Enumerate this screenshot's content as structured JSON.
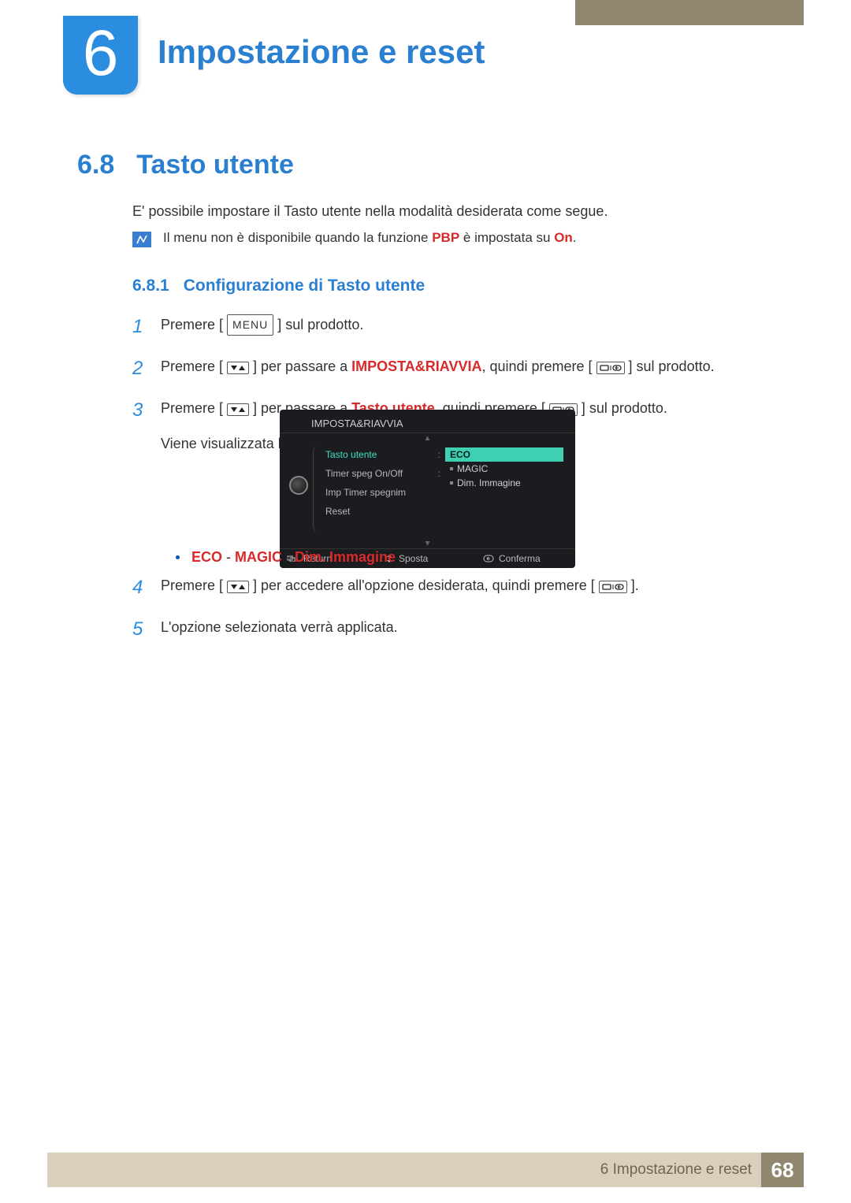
{
  "chapter": {
    "num": "6",
    "title": "Impostazione e reset"
  },
  "section": {
    "num": "6.8",
    "title": "Tasto utente"
  },
  "intro": "E' possibile impostare il Tasto utente nella modalità desiderata come segue.",
  "note": {
    "pre": "Il menu non è disponibile quando la funzione ",
    "pbp": "PBP",
    "mid": " è impostata su ",
    "on": "On",
    "post": "."
  },
  "subsection": {
    "num": "6.8.1",
    "title": "Configurazione di Tasto utente"
  },
  "buttons": {
    "menu": "MENU"
  },
  "steps": {
    "s1": {
      "n": "1",
      "a": "Premere [ ",
      "b": " ] sul prodotto."
    },
    "s2": {
      "n": "2",
      "a": "Premere [ ",
      "b": " ] per passare a ",
      "kw": "IMPOSTA&RIAVVIA",
      "c": ", quindi premere [ ",
      "d": " ] sul prodotto."
    },
    "s3": {
      "n": "3",
      "a": "Premere [ ",
      "b": " ] per passare a ",
      "kw": "Tasto utente",
      "c": ", quindi premere [ ",
      "d": " ] sul prodotto."
    },
    "s3b": "Viene visualizzata la seguente schermata.",
    "s4": {
      "n": "4",
      "a": "Premere [ ",
      "b": " ] per accedere all'opzione desiderata, quindi premere [ ",
      "c": " ]."
    },
    "s5": {
      "n": "5",
      "a": "L'opzione selezionata verrà applicata."
    }
  },
  "bullet": {
    "eco": "ECO",
    "sep": " - ",
    "magic": "MAGIC",
    "dim": "Dim. Immagine"
  },
  "osd": {
    "header": "IMPOSTA&RIAVVIA",
    "left": {
      "r1": "Tasto utente",
      "r2": "Timer speg On/Off",
      "r3": "Imp Timer spegnim",
      "r4": "Reset"
    },
    "right": {
      "o1": "ECO",
      "o2": "MAGIC",
      "o3": "Dim. Immagine"
    },
    "footer": {
      "return": "Return",
      "sposta": "Sposta",
      "conferma": "Conferma"
    }
  },
  "footer": {
    "text": "6 Impostazione e reset",
    "page": "68"
  }
}
